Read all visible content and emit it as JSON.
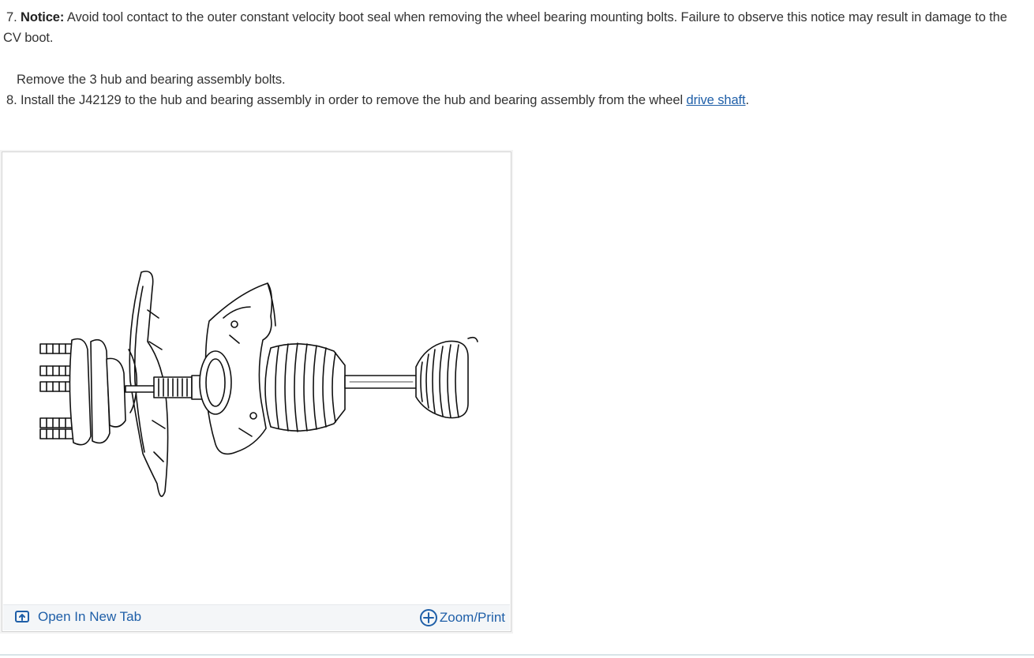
{
  "steps": {
    "step7": {
      "number": "7.",
      "notice_label": "Notice:",
      "text": " Avoid tool contact to the outer constant velocity boot seal when removing the wheel bearing mounting bolts. Failure to observe this notice may result in damage to the CV boot."
    },
    "substep": {
      "text": "Remove the 3 hub and bearing assembly bolts."
    },
    "step8": {
      "number": "8.",
      "text": " Install the J42129 to the hub and bearing assembly in order to remove the hub and bearing assembly from the wheel ",
      "link_text": "drive shaft",
      "trailing": "."
    }
  },
  "figure": {
    "open_tab_label": "Open In New Tab",
    "zoom_print_label": "Zoom/Print",
    "icons": {
      "open_tab": "open-in-new-tab-icon",
      "zoom": "zoom-plus-icon"
    }
  },
  "colors": {
    "link": "#1f5fa8",
    "text": "#333333",
    "bar_bg": "#f4f6f8"
  }
}
